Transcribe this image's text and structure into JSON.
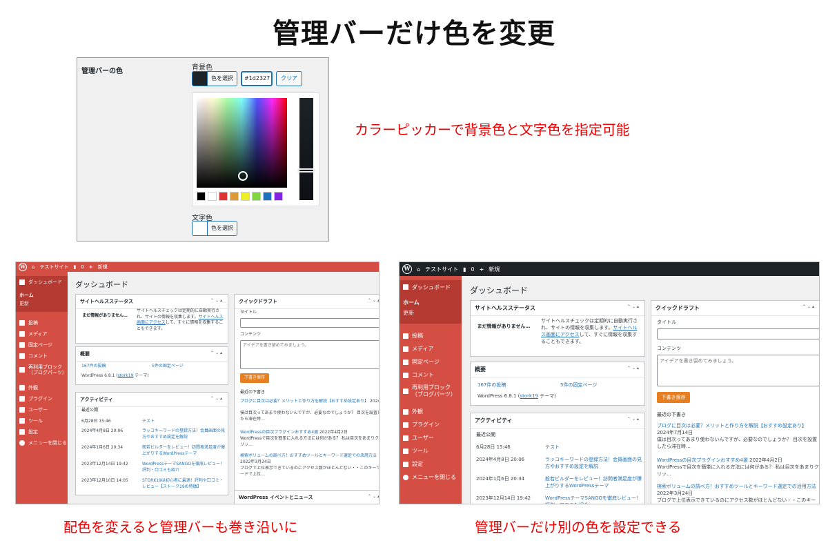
{
  "page_title": "管理バーだけ色を変更",
  "settings": {
    "section_label": "管理バーの色",
    "bg_label": "背景色",
    "bg_button": "色を選択",
    "bg_hex": "#1d2327",
    "bg_color": "#1d2327",
    "clear_button": "クリア",
    "text_label": "文字色",
    "text_button": "色を選択",
    "palette": [
      "#000000",
      "#ffffff",
      "#dd3333",
      "#dd9933",
      "#eeee22",
      "#81d742",
      "#1e73be",
      "#8224e3"
    ]
  },
  "annotations": {
    "picker": "カラーピッカーで背景色と文字色を指定可能",
    "left": "配色を変えると管理バーも巻き沿いに",
    "right": "管理バーだけ別の色を設定できる"
  },
  "dash": {
    "site_name": "テストサイト",
    "comments_count": "0",
    "new_label": "新規",
    "sidebar": {
      "dashboard": "ダッシュボード",
      "home": "ホーム",
      "updates": "更新",
      "items": [
        "投稿",
        "メディア",
        "固定ページ",
        "コメント",
        "再利用ブロック\n（ブログパーツ）",
        "外観",
        "プラグイン",
        "ユーザー",
        "ツール",
        "設定",
        "メニューを閉じる"
      ]
    },
    "heading": "ダッシュボード",
    "health": {
      "title": "サイトヘルスステータス",
      "status": "まだ情報がありません…",
      "desc_before": "サイトヘルスチェックは定期的に自動実行され、サイトの情報を収集します。",
      "desc_link": "サイトヘルス画面にアクセス",
      "desc_after": "して、すぐに情報を収集することもできます。"
    },
    "glance": {
      "title": "概要",
      "posts": "167件の投稿",
      "pages": "5件の固定ページ",
      "version_before": "WordPress 6.8.1 (",
      "theme": "stork19",
      "version_after": " テーマ)"
    },
    "activity": {
      "title": "アクティビティ",
      "recent": "最近公開",
      "rows": [
        {
          "date": "6月28日 15:46",
          "title": "テスト"
        },
        {
          "date": "2024年4月8日 20:06",
          "title": "ラッコキーワードの登録方法！会員画面の見方やおすすめ設定を解説"
        },
        {
          "date": "2024年1月6日 20:34",
          "title": "般若ビルダーをレビュー！訪問者満足度が爆上がりするWordPressテーマ"
        },
        {
          "date": "2023年12月14日 19:42",
          "title": "WordPressテーマSANGOを徹底レビュー！評判・口コミも紹介"
        },
        {
          "date": "2023年12月10日 14:05",
          "title": "STORK19は初心者に最適！評判や口コミ・レビュー【ストーク19の特徴】"
        }
      ]
    },
    "draft": {
      "title": "クイックドラフト",
      "title_label": "タイトル",
      "content_label": "コンテンツ",
      "placeholder": "アイデアを書き留めてみましょう。",
      "save": "下書き保存",
      "recent_title": "最近の下書き",
      "items": [
        {
          "title": "ブログに目次は必要？メリットと作り方を解説【おすすめ設定あり】",
          "date": "2024年7月14日",
          "excerpt": "僕は目次ってあまり使わないんですが、必要なのでしょうか？ 目次を設置したら滞在時…"
        },
        {
          "title": "WordPressの目次プラグインおすすめ4選",
          "date": "2022年4月2日",
          "excerpt": "WordPressで目次を簡単に入れる方法には何がある？ 私は目次をあまりクリッ…"
        },
        {
          "title": "検索ボリュームの調べ方！おすすめツールとキーワード選定での活用方法",
          "date": "2022年3月24日",
          "excerpt": "ブログで上位表示できているのにアクセス数がほとんどない・・このキーワードで上位…"
        }
      ]
    },
    "events_title": "WordPress イベントとニュース"
  },
  "colors": {
    "red_scheme": "#d54e44",
    "red_dark": "#b53a31",
    "bar_dark": "#1d2327",
    "menu_current": "#e57f1f"
  }
}
